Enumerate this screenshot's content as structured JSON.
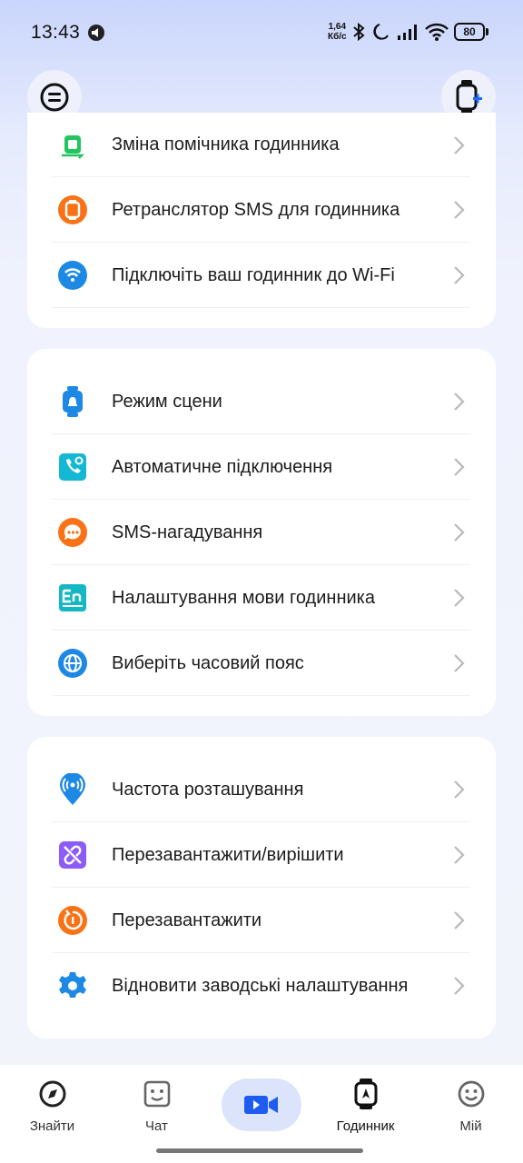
{
  "status_bar": {
    "time": "13:43",
    "net_speed_value": "1,64",
    "net_speed_unit": "Кб/с",
    "battery": "80"
  },
  "header": {
    "left_button_icon": "menu-circle-icon",
    "right_button_icon": "watch-add-icon"
  },
  "cards": [
    {
      "items": [
        {
          "label": "Зміна помічника годинника",
          "icon": "watch-swap-icon",
          "color": "#22c55e"
        },
        {
          "label": "Ретранслятор SMS для годинника",
          "icon": "watch-sms-icon",
          "color": "#f97316"
        },
        {
          "label": "Підключіть ваш годинник до Wi-Fi",
          "icon": "wifi-icon",
          "color": "#1e88e5"
        }
      ]
    },
    {
      "items": [
        {
          "label": "Режим сцени",
          "icon": "watch-bell-icon",
          "color": "#1e88e5"
        },
        {
          "label": "Автоматичне підключення",
          "icon": "auto-call-icon",
          "color": "#14b8d4"
        },
        {
          "label": "SMS-нагадування",
          "icon": "sms-chat-icon",
          "color": "#f97316"
        },
        {
          "label": "Налаштування мови годинника",
          "icon": "language-icon",
          "color": "#14b8c4"
        },
        {
          "label": "Виберіть часовий пояс",
          "icon": "globe-icon",
          "color": "#1e88e5"
        }
      ]
    },
    {
      "items": [
        {
          "label": "Частота розташування",
          "icon": "location-signal-icon",
          "color": "#1e88e5"
        },
        {
          "label": "Перезавантажити/вирішити",
          "icon": "unlink-icon",
          "color": "#8b5cf6"
        },
        {
          "label": "Перезавантажити",
          "icon": "restart-icon",
          "color": "#f97316"
        },
        {
          "label": "Відновити заводські налаштування",
          "icon": "gear-icon",
          "color": "#1e88e5"
        }
      ]
    }
  ],
  "bottom_nav": {
    "items": [
      {
        "label": "Знайти",
        "icon": "compass-icon"
      },
      {
        "label": "Чат",
        "icon": "chat-face-icon"
      },
      {
        "label": "",
        "icon": "video-call-icon"
      },
      {
        "label": "Годинник",
        "icon": "watch-icon",
        "active": true
      },
      {
        "label": "Мій",
        "icon": "smile-icon"
      }
    ]
  }
}
